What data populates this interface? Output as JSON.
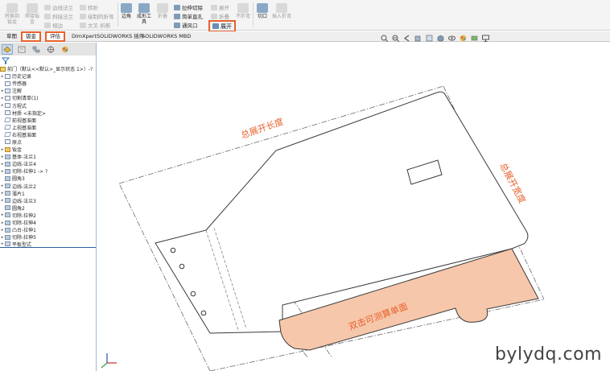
{
  "ribbon": {
    "buttons": [
      {
        "label": "转换到钣金",
        "state": "disabled"
      },
      {
        "label": "焊接钣金",
        "state": "disabled"
      },
      {
        "label": "边角",
        "state": "enabled"
      },
      {
        "label": "成形工具",
        "state": "enabled"
      },
      {
        "label": "折叠",
        "state": "disabled"
      },
      {
        "label": "不折弯",
        "state": "disabled"
      },
      {
        "label": "切口",
        "state": "enabled"
      },
      {
        "label": "插入折弯",
        "state": "disabled"
      }
    ],
    "rows": [
      {
        "label": "边线法兰",
        "state": "disabled"
      },
      {
        "label": "斜接法兰",
        "state": "disabled"
      },
      {
        "label": "褶边",
        "state": "disabled"
      },
      {
        "label": "转折",
        "state": "disabled"
      },
      {
        "label": "绘制的折弯",
        "state": "disabled"
      },
      {
        "label": "文叉-折断",
        "state": "disabled"
      },
      {
        "label": "拉伸切除",
        "state": "enabled"
      },
      {
        "label": "简单直孔",
        "state": "enabled"
      },
      {
        "label": "通风口",
        "state": "enabled"
      },
      {
        "label": "展开",
        "state": "disabled"
      },
      {
        "label": "折叠",
        "state": "disabled"
      }
    ],
    "unfold_label": "展开"
  },
  "tabs": [
    "草图",
    "钣金",
    "评估",
    "DimXpert",
    "SOLIDWORKS 插件",
    "SOLIDWORKS MBD"
  ],
  "view_icons": [
    "zoom-fit-icon",
    "zoom-area-icon",
    "previous-view-icon",
    "section-view-icon",
    "view-orientation-icon",
    "display-style-icon",
    "hide-show-icon",
    "appearance-icon",
    "scene-icon",
    "monitor-icon"
  ],
  "panel": {
    "tab_icons": [
      "feature-manager-icon",
      "property-manager-icon",
      "configuration-manager-icon",
      "dimxpert-icon",
      "display-manager-icon"
    ],
    "root": "前门（默认<<默认>_显示状态 1>）-?",
    "tree": [
      {
        "label": "历史记录",
        "icon": "history-icon",
        "arrow": true
      },
      {
        "label": "传感器",
        "icon": "sensor-icon",
        "arrow": false
      },
      {
        "label": "注解",
        "icon": "annotation-icon",
        "arrow": true
      },
      {
        "label": "切割清单(1)",
        "icon": "cut-list-icon",
        "arrow": true
      },
      {
        "label": "方程式",
        "icon": "equation-icon",
        "arrow": true
      },
      {
        "label": "材质 <未指定>",
        "icon": "material-icon",
        "arrow": false
      },
      {
        "label": "前视基准面",
        "icon": "plane-icon",
        "arrow": false
      },
      {
        "label": "上视基准面",
        "icon": "plane-icon",
        "arrow": false
      },
      {
        "label": "右视基准面",
        "icon": "plane-icon",
        "arrow": false
      },
      {
        "label": "原点",
        "icon": "origin-icon",
        "arrow": false
      },
      {
        "label": "钣金",
        "icon": "sheet-metal-icon",
        "arrow": true
      },
      {
        "label": "基体-法兰1",
        "icon": "feature-icon",
        "arrow": true
      },
      {
        "label": "边线-法兰4",
        "icon": "feature-icon",
        "arrow": true
      },
      {
        "label": "切除-拉伸1 -> ?",
        "icon": "feature-icon",
        "arrow": true
      },
      {
        "label": "圆角3",
        "icon": "feature-icon",
        "arrow": false
      },
      {
        "label": "边线-法兰2",
        "icon": "feature-icon",
        "arrow": true
      },
      {
        "label": "薄片1",
        "icon": "feature-icon",
        "arrow": true
      },
      {
        "label": "边线-法兰3",
        "icon": "feature-icon",
        "arrow": true
      },
      {
        "label": "圆角2",
        "icon": "feature-icon",
        "arrow": false
      },
      {
        "label": "切除-拉伸2",
        "icon": "feature-icon",
        "arrow": true
      },
      {
        "label": "切除-拉伸4",
        "icon": "feature-icon",
        "arrow": true
      },
      {
        "label": "凸台-拉伸1",
        "icon": "feature-icon",
        "arrow": true
      },
      {
        "label": "切除-拉伸5",
        "icon": "feature-icon",
        "arrow": true
      },
      {
        "label": "平板型式",
        "icon": "flat-pattern-icon",
        "arrow": true
      }
    ]
  },
  "graphics": {
    "label_total_length": "总展开长度",
    "label_total_width": "总展开宽度",
    "label_click_face": "双击可测算单面",
    "face_color": "#f6c7ab",
    "annotation_color": "#e8612c"
  },
  "watermark": "bylydq.com",
  "colors": {
    "accent": "#e8612c",
    "selection": "#dbe7f4"
  }
}
